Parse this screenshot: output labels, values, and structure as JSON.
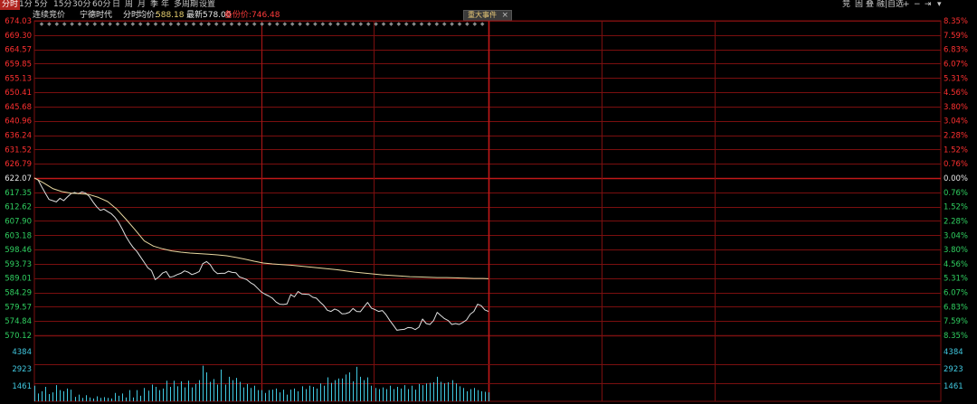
{
  "toolbar": {
    "tabs": [
      "分时",
      "1分",
      "5分",
      "15分",
      "30分",
      "60分",
      "日",
      "周",
      "月",
      "季",
      "年",
      "多周期",
      "设置"
    ],
    "active_tab": "分时",
    "right_items": [
      "竞",
      "固",
      "叠",
      "融|自选",
      "+",
      "−",
      "⇥",
      "▾"
    ]
  },
  "infobar": {
    "mode": "连续竞价",
    "stock_name": "宁德时代",
    "chart_kind": "分时",
    "avg_label": "均价:",
    "avg_value": "588.18",
    "last_label": "最新:",
    "last_value": "578.00",
    "adjusted_label": "备份价:",
    "adjusted_value": "746.48"
  },
  "event_tab": {
    "label": "重大事件",
    "close": "×"
  },
  "colors": {
    "background": "#000000",
    "grid": "#7a0f0f",
    "up": "#ff3030",
    "down": "#30d060",
    "price_line": "#e0e0e0",
    "avg_line": "#e8d8a0",
    "volume": "#40c8e0",
    "active_tab": "#b0231e"
  },
  "chart_data": [
    {
      "type": "line",
      "base_price": 622.07,
      "ylim": [
        570.12,
        674.03
      ],
      "y_ticks_left": [
        "674.03",
        "669.30",
        "664.57",
        "659.85",
        "655.13",
        "650.41",
        "645.68",
        "640.96",
        "636.24",
        "631.52",
        "626.79",
        "622.07",
        "617.35",
        "612.62",
        "607.90",
        "603.18",
        "598.46",
        "593.73",
        "589.01",
        "584.29",
        "579.57",
        "574.84",
        "570.12"
      ],
      "y_ticks_right": [
        "8.35%",
        "7.59%",
        "6.83%",
        "6.07%",
        "5.31%",
        "4.56%",
        "3.80%",
        "3.04%",
        "2.28%",
        "1.52%",
        "0.76%",
        "0.00%",
        "0.76%",
        "1.52%",
        "2.28%",
        "3.04%",
        "3.80%",
        "4.56%",
        "5.31%",
        "6.07%",
        "6.83%",
        "7.59%",
        "8.35%"
      ],
      "x_minutes_total": 240,
      "series": [
        {
          "role": "price",
          "x": [
            0,
            2,
            4,
            6,
            8,
            10,
            12,
            14,
            16,
            18,
            20,
            22,
            24,
            26,
            28,
            30,
            32,
            34,
            36,
            38,
            40,
            42,
            44,
            46,
            48,
            50,
            52,
            54,
            56,
            58,
            60,
            62,
            64,
            66,
            68,
            70,
            72,
            74,
            76,
            78,
            80,
            82,
            84,
            86,
            88,
            90,
            92,
            94,
            96,
            98,
            100,
            102,
            104,
            106,
            108,
            110,
            112,
            114,
            116,
            118,
            120,
            122,
            124,
            126,
            128,
            130,
            132,
            134,
            136,
            138,
            140,
            142,
            144,
            146,
            148,
            150,
            152,
            154,
            156,
            158,
            160,
            162,
            164,
            166,
            168,
            170,
            172,
            174,
            176,
            178,
            180,
            182,
            184,
            186,
            188,
            190,
            192,
            194,
            196,
            198,
            200,
            202,
            204,
            206,
            208,
            210,
            212,
            214,
            216,
            218,
            220,
            222,
            224,
            226,
            228,
            230,
            232,
            234,
            236,
            238,
            240,
            242,
            244,
            246,
            248
          ],
          "values": [
            622.1,
            621.5,
            619.2,
            617.1,
            615.0,
            614.6,
            614.2,
            615.4,
            614.6,
            615.8,
            616.9,
            617.3,
            616.9,
            617.5,
            617.1,
            616.0,
            614.2,
            612.6,
            611.4,
            611.8,
            611.0,
            610.3,
            609.1,
            607.4,
            605.2,
            602.8,
            600.8,
            599.1,
            597.8,
            596.0,
            594.2,
            592.4,
            591.5,
            588.5,
            589.4,
            590.7,
            591.2,
            589.3,
            589.6,
            590.2,
            590.6,
            591.4,
            591.0,
            590.2,
            590.6,
            591.2,
            593.8,
            594.5,
            593.5,
            591.5,
            590.5,
            590.6,
            590.6,
            591.3,
            590.9,
            590.8,
            589.4,
            589.0,
            588.5,
            587.5,
            586.8,
            585.6,
            584.4,
            583.7,
            583.1,
            582.4,
            581.1,
            580.4,
            580.3,
            580.5,
            583.6,
            582.8,
            584.6,
            583.8,
            583.7,
            583.6,
            582.7,
            582.4,
            581.1,
            580.0,
            578.4,
            578.0,
            578.8,
            578.3,
            577.2,
            577.3,
            577.7,
            579.0,
            578.0,
            577.9,
            579.5,
            581.0,
            579.1,
            578.6,
            578.0,
            578.3,
            577.0,
            575.1,
            573.5,
            571.8,
            572.0,
            572.1,
            572.7,
            572.6,
            572.0,
            572.8,
            575.5,
            574.0,
            573.7,
            575.0,
            577.7,
            576.6,
            575.6,
            575.0,
            573.7,
            574.0,
            573.7,
            574.4,
            575.2,
            577.1,
            578.0,
            580.4,
            579.9,
            578.5,
            578.0
          ]
        },
        {
          "role": "average",
          "x": [
            0,
            5,
            10,
            15,
            20,
            25,
            30,
            35,
            40,
            45,
            50,
            55,
            60,
            65,
            70,
            75,
            80,
            85,
            90,
            95,
            100,
            105,
            110,
            115,
            120,
            125,
            130,
            135,
            140,
            145,
            150,
            155,
            160,
            165,
            170,
            175,
            180,
            185,
            190,
            195,
            200,
            205,
            210,
            215,
            220,
            225,
            230,
            235,
            240,
            245,
            248
          ],
          "values": [
            622.1,
            620.5,
            618.6,
            617.6,
            617.1,
            616.9,
            616.6,
            615.7,
            614.3,
            611.8,
            608.5,
            605.0,
            601.3,
            599.6,
            598.7,
            598.0,
            597.6,
            597.3,
            597.1,
            596.9,
            596.7,
            596.4,
            595.9,
            595.3,
            594.6,
            594.0,
            593.7,
            593.5,
            593.3,
            593.0,
            592.7,
            592.4,
            592.1,
            591.8,
            591.4,
            591.0,
            590.7,
            590.4,
            590.1,
            589.9,
            589.7,
            589.5,
            589.4,
            589.3,
            589.2,
            589.2,
            589.1,
            589.0,
            588.9,
            588.9,
            588.8
          ]
        }
      ]
    },
    {
      "type": "bar",
      "role": "volume",
      "y_ticks": [
        "4384",
        "2923",
        "1461"
      ],
      "ylim": [
        0,
        5845
      ],
      "x": [
        0,
        2,
        4,
        6,
        8,
        10,
        12,
        14,
        16,
        18,
        20,
        22,
        24,
        26,
        28,
        30,
        32,
        34,
        36,
        38,
        40,
        42,
        44,
        46,
        48,
        50,
        52,
        54,
        56,
        58,
        60,
        62,
        64,
        66,
        68,
        70,
        72,
        74,
        76,
        78,
        80,
        82,
        84,
        86,
        88,
        90,
        92,
        94,
        96,
        98,
        100,
        102,
        104,
        106,
        108,
        110,
        112,
        114,
        116,
        118,
        120,
        122,
        124,
        126,
        128,
        130,
        132,
        134,
        136,
        138,
        140,
        142,
        144,
        146,
        148,
        150,
        152,
        154,
        156,
        158,
        160,
        162,
        164,
        166,
        168,
        170,
        172,
        174,
        176,
        178,
        180,
        182,
        184,
        186,
        188,
        190,
        192,
        194,
        196,
        198,
        200,
        202,
        204,
        206,
        208,
        210,
        212,
        214,
        216,
        218,
        220,
        222,
        224,
        226,
        228,
        230,
        232,
        234,
        236,
        238,
        240,
        242,
        244,
        246,
        248
      ],
      "values": [
        1400,
        700,
        900,
        1300,
        650,
        800,
        1450,
        1000,
        900,
        1150,
        1050,
        400,
        600,
        300,
        550,
        350,
        250,
        450,
        300,
        380,
        300,
        250,
        750,
        500,
        700,
        350,
        1000,
        350,
        1000,
        500,
        1200,
        950,
        1500,
        1300,
        1000,
        1150,
        1850,
        1300,
        1850,
        1350,
        1800,
        1250,
        1850,
        1250,
        1550,
        1900,
        3200,
        2600,
        1750,
        2000,
        1500,
        2850,
        1500,
        2200,
        1900,
        2100,
        1750,
        1250,
        1550,
        1200,
        1400,
        1000,
        1000,
        750,
        1000,
        1050,
        1150,
        800,
        1050,
        600,
        1050,
        1150,
        900,
        1350,
        1100,
        1400,
        1300,
        1150,
        1600,
        1400,
        2150,
        1650,
        1900,
        2050,
        2050,
        2400,
        2600,
        1800,
        3100,
        2200,
        1900,
        2150,
        1400,
        1200,
        1100,
        1250,
        1100,
        1400,
        1100,
        1300,
        1150,
        1450,
        1100,
        1400,
        1050,
        1550,
        1450,
        1600,
        1650,
        1700,
        2200,
        1750,
        1600,
        1700,
        1900,
        1600,
        1350,
        1200,
        900,
        1100,
        1200,
        1000,
        900,
        850,
        800
      ]
    }
  ]
}
